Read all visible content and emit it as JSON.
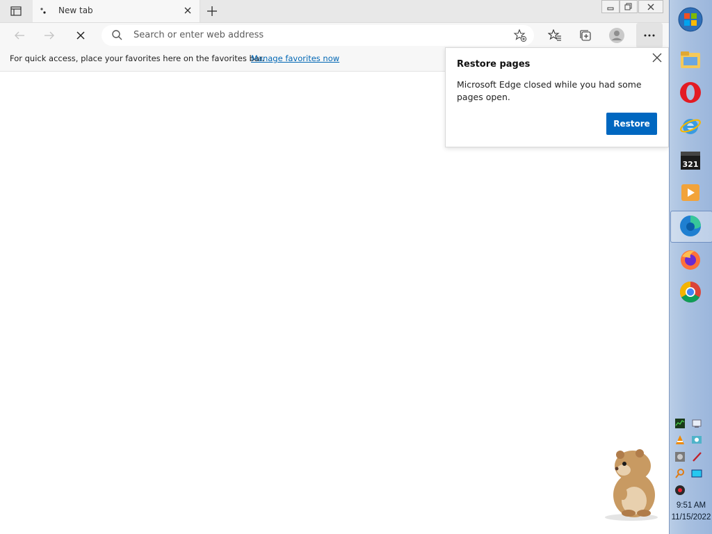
{
  "browser": {
    "tab": {
      "title": "New tab"
    },
    "address_bar": {
      "placeholder": "Search or enter web address"
    },
    "favorites_bar": {
      "message": "For quick access, place your favorites here on the favorites bar.",
      "link": "Manage favorites now"
    },
    "restore_popup": {
      "title": "Restore pages",
      "body": "Microsoft Edge closed while you had some pages open.",
      "button": "Restore"
    }
  },
  "taskbar": {
    "apps": [
      "start-orb-icon",
      "file-explorer-icon",
      "opera-icon",
      "internet-explorer-icon",
      "media-player-classic-icon",
      "video-player-icon",
      "edge-icon",
      "firefox-icon",
      "chrome-icon"
    ],
    "active_app": "edge-icon",
    "clock": {
      "time": "9:51 AM",
      "date": "11/15/2022"
    }
  },
  "colors": {
    "accent": "#0067c0",
    "link": "#0066b4",
    "taskbar": "#a8c0e0"
  }
}
